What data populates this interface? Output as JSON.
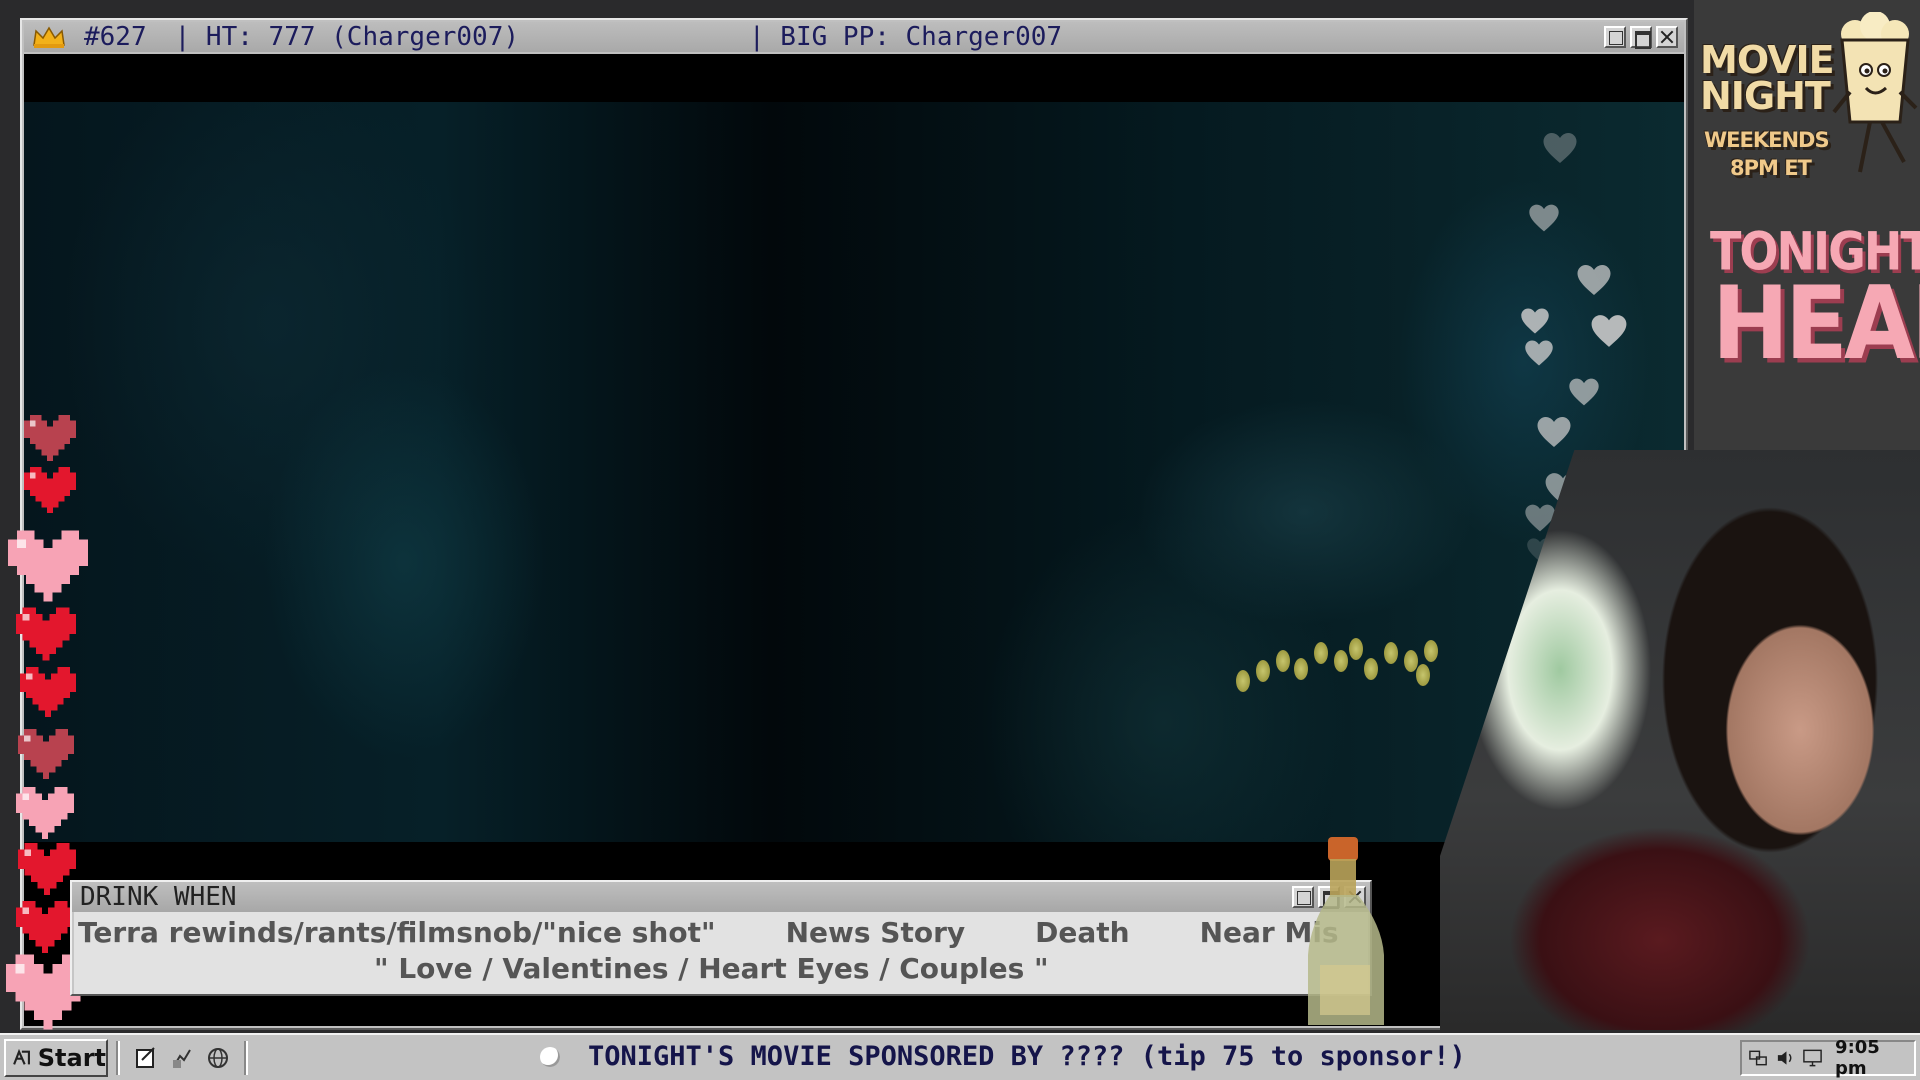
{
  "movie_window": {
    "title_rank": "#627",
    "title_ht": "| HT: 777 (Charger007)",
    "title_bigpp": "| BIG PP: Charger007",
    "accent_color": "#1c1c5c"
  },
  "drink_window": {
    "title": "DRINK WHEN",
    "items_row1": [
      "Terra rewinds/rants/filmsnob/\"nice shot\"",
      "News Story",
      "Death",
      "Near Mis"
    ],
    "items_row2": "\" Love / Valentines / Heart Eyes / Couples \""
  },
  "sidebar": {
    "logo_line1": "MOVIE",
    "logo_line2": "NIGHT",
    "logo_line3": "WEEKENDS",
    "logo_line4": "8PM ET",
    "tonight_label": "TONIGHT:",
    "tonight_title": "HEAR"
  },
  "taskbar": {
    "start_label": "Start",
    "ticker_text": "TONIGHT'S MOVIE SPONSORED BY ???? (tip 75 to sponsor!)",
    "clock": "9:05 pm",
    "quick_icons": [
      "notepad-icon",
      "paint-icon",
      "browser-icon"
    ],
    "tray_icons": [
      "network-icon",
      "volume-icon",
      "monitor-icon"
    ]
  },
  "colors": {
    "heart_pink": "#f7a3b5",
    "heart_red": "#e3172d",
    "heart_dark": "#b8424f",
    "title_pink": "#f6a8b4"
  }
}
